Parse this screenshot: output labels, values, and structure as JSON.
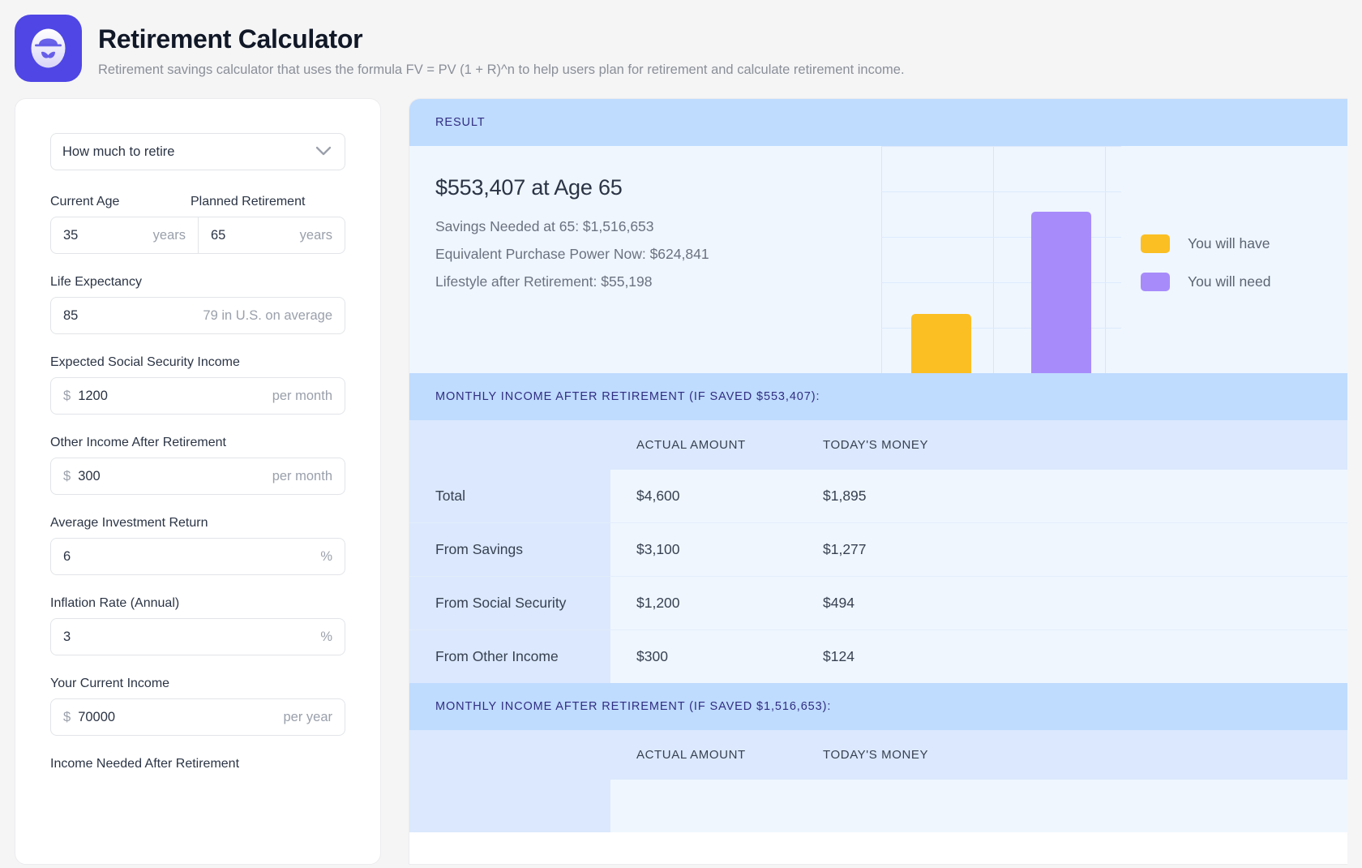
{
  "header": {
    "title": "Retirement Calculator",
    "subtitle": "Retirement savings calculator that uses the formula FV = PV (1 + R)^n to help users plan for retirement and calculate retirement income.",
    "icon": "gentleman-avatar-icon"
  },
  "form": {
    "mode_select": {
      "value": "How much to retire",
      "icon": "chevron-down-icon"
    },
    "current_age": {
      "label": "Current Age",
      "value": "35",
      "suffix": "years"
    },
    "planned_retirement": {
      "label": "Planned Retirement",
      "value": "65",
      "suffix": "years"
    },
    "life_expectancy": {
      "label": "Life Expectancy",
      "value": "85",
      "suffix": "79 in U.S. on average"
    },
    "social_security": {
      "label": "Expected Social Security Income",
      "prefix": "$",
      "value": "1200",
      "suffix": "per month"
    },
    "other_income": {
      "label": "Other Income After Retirement",
      "prefix": "$",
      "value": "300",
      "suffix": "per month"
    },
    "investment_return": {
      "label": "Average Investment Return",
      "value": "6",
      "suffix": "%"
    },
    "inflation_rate": {
      "label": "Inflation Rate (Annual)",
      "value": "3",
      "suffix": "%"
    },
    "current_income": {
      "label": "Your Current Income",
      "prefix": "$",
      "value": "70000",
      "suffix": "per year"
    },
    "income_needed": {
      "label": "Income Needed After Retirement"
    }
  },
  "result": {
    "band_label": "RESULT",
    "headline": "$553,407 at Age 65",
    "lines": [
      "Savings Needed at 65: $1,516,653",
      "Equivalent Purchase Power Now: $624,841",
      "Lifestyle after Retirement: $55,198"
    ]
  },
  "chart_data": {
    "type": "bar",
    "title": "",
    "categories": [
      "You will have",
      "You will need"
    ],
    "values": [
      553407,
      1516653
    ],
    "ylim": [
      0,
      1750000
    ],
    "grid": true,
    "legend_position": "right",
    "colors": {
      "have": "#FBBF24",
      "need": "#A78BFA"
    },
    "series": [
      {
        "name": "You will have",
        "values": [
          553407
        ],
        "color": "#FBBF24"
      },
      {
        "name": "You will need",
        "values": [
          1516653
        ],
        "color": "#A78BFA"
      }
    ],
    "xlabel": "",
    "ylabel": ""
  },
  "tables": [
    {
      "band_label": "MONTHLY INCOME AFTER RETIREMENT (IF SAVED $553,407):",
      "columns": [
        "",
        "ACTUAL AMOUNT",
        "TODAY'S MONEY"
      ],
      "rows": [
        [
          "Total",
          "$4,600",
          "$1,895"
        ],
        [
          "From Savings",
          "$3,100",
          "$1,277"
        ],
        [
          "From Social Security",
          "$1,200",
          "$494"
        ],
        [
          "From Other Income",
          "$300",
          "$124"
        ]
      ]
    },
    {
      "band_label": "MONTHLY INCOME AFTER RETIREMENT (IF SAVED $1,516,653):",
      "columns": [
        "",
        "ACTUAL AMOUNT",
        "TODAY'S MONEY"
      ],
      "rows": []
    }
  ]
}
